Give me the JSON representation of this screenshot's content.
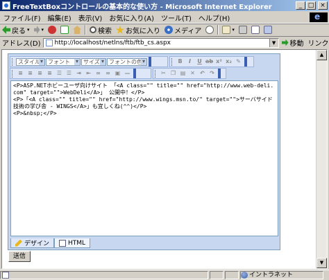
{
  "window": {
    "title": "FreeTextBoxコントロールの基本的な使い方 - Microsoft Internet Explorer",
    "buttons": [
      "_",
      "□",
      "×"
    ]
  },
  "menu": [
    "ファイル(F)",
    "編集(E)",
    "表示(V)",
    "お気に入り(A)",
    "ツール(T)",
    "ヘルプ(H)"
  ],
  "toolbar": {
    "back": "戻る",
    "search": "検索",
    "favorites": "お気に入り",
    "media": "メディア"
  },
  "address": {
    "label": "アドレス(D)",
    "url": "http://localhost/netlns/ftb/ftb_cs.aspx",
    "go": "移動",
    "links": "リンク"
  },
  "editor": {
    "style": "スタイル",
    "font": "フォント",
    "size": "サイズ",
    "color": "フォントの色",
    "buttons_row1": [
      "B",
      "I",
      "U",
      "ab",
      "x²",
      "x₂",
      "✎"
    ],
    "content": "<P>ASP.NETホビーユーザ向けサイト 「<A class=\"\" title=\"\" href=\"http://www.web-deli.com\" target=\"\">WebDeli</A>」 公開中！</P>\n<P>「<A class=\"\" title=\"\" href=\"http://www.wings.msn.to/\" target=\"\">サーバサイド技術の学び舎 - WINGS</A>」も宜しくね(^^)</P>\n<P>&nbsp;</P>",
    "tabs": [
      "デザイン",
      "HTML"
    ]
  },
  "submit": "送信",
  "status": {
    "zone": "イントラネット"
  }
}
